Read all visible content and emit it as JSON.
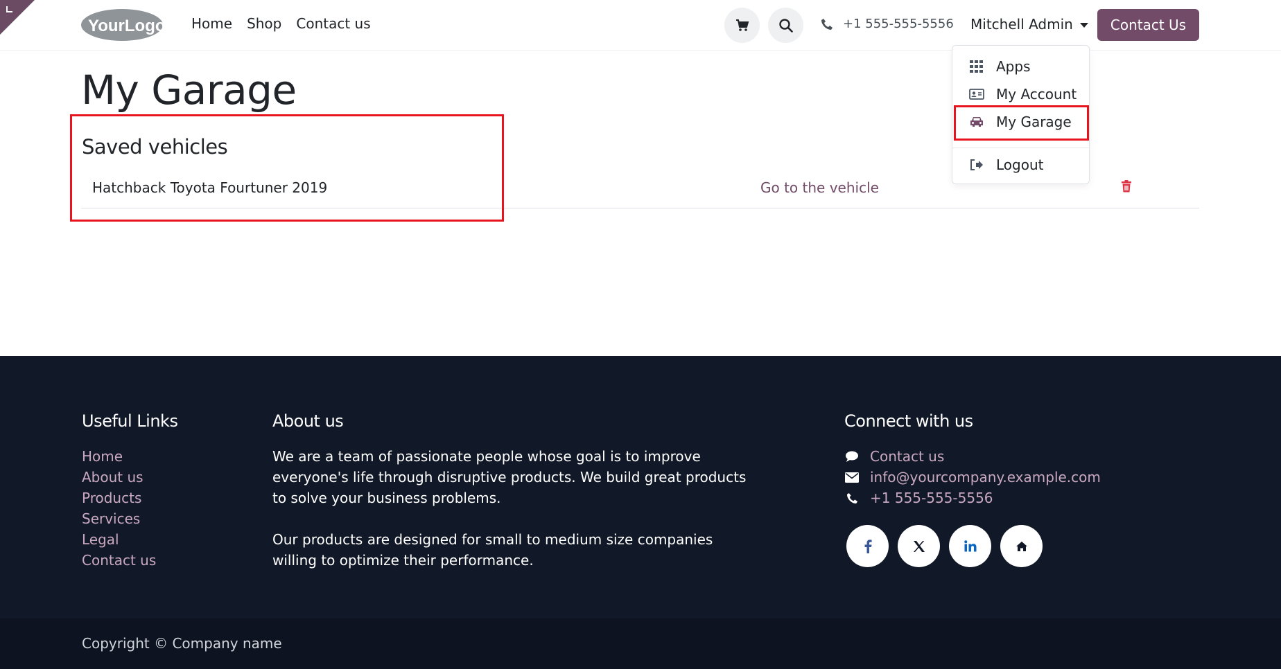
{
  "header": {
    "logo_text": "YourLogo",
    "nav": [
      "Home",
      "Shop",
      "Contact us"
    ],
    "phone": "+1 555-555-5556",
    "user_name": "Mitchell Admin",
    "cta_label": "Contact Us"
  },
  "user_menu": {
    "items": [
      {
        "label": "Apps",
        "icon": "grid-icon"
      },
      {
        "label": "My Account",
        "icon": "id-card-icon"
      },
      {
        "label": "My Garage",
        "icon": "car-icon"
      },
      {
        "label": "Logout",
        "icon": "sign-out-icon"
      }
    ]
  },
  "main": {
    "title": "My Garage",
    "section_title": "Saved vehicles",
    "vehicles": [
      {
        "name": "Hatchback Toyota Fourtuner 2019",
        "link_label": "Go to the vehicle"
      }
    ]
  },
  "footer": {
    "useful_links_title": "Useful Links",
    "useful_links": [
      "Home",
      "About us",
      "Products",
      "Services",
      "Legal",
      "Contact us"
    ],
    "about_title": "About us",
    "about_lines_1": [
      "We are a team of passionate people whose goal is to improve",
      "everyone's life through disruptive products. We build great products",
      "to solve your business problems."
    ],
    "about_lines_2": [
      "Our products are designed for small to medium size companies",
      "willing to optimize their performance."
    ],
    "connect_title": "Connect with us",
    "connect_items": [
      {
        "label": "Contact us",
        "icon": "comment-icon"
      },
      {
        "label": "info@yourcompany.example.com",
        "icon": "envelope-icon"
      },
      {
        "label": "+1 555-555-5556",
        "icon": "phone-icon"
      }
    ],
    "social": [
      "facebook-icon",
      "x-twitter-icon",
      "linkedin-icon",
      "home-icon"
    ],
    "copyright": "Copyright © Company name"
  },
  "colors": {
    "brand": "#714b67",
    "footer_bg": "#111827",
    "footer_link": "#c9a8c1",
    "highlight": "#e8141d",
    "trash": "#dc3545"
  }
}
